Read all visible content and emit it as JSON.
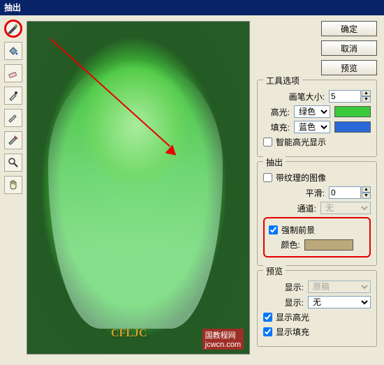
{
  "title": "抽出",
  "buttons": {
    "ok": "确定",
    "cancel": "取消",
    "preview": "预览"
  },
  "tool_options": {
    "title": "工具选项",
    "brush_size_label": "画笔大小:",
    "brush_size": "5",
    "highlight_label": "高光:",
    "highlight_value": "绿色",
    "fill_label": "填充:",
    "fill_value": "蓝色",
    "smart_highlight_label": "智能高光显示"
  },
  "extract": {
    "title": "抽出",
    "textured_label": "带纹理的图像",
    "smooth_label": "平滑:",
    "smooth_value": "0",
    "channel_label": "通道:",
    "channel_value": "无",
    "force_fg_label": "强制前景",
    "color_label": "颜色:"
  },
  "preview_group": {
    "title": "预览",
    "show_label": "显示:",
    "show_value": "原稿",
    "display_label": "显示:",
    "display_value": "无",
    "show_highlight": "显示高光",
    "show_fill": "显示填充"
  },
  "canvas": {
    "watermark": "CFLJC",
    "watermark2": "国教程网",
    "watermark3": "jcwcn.com"
  },
  "tools": {
    "edge": "edge-highlighter-icon",
    "fill": "fill-icon",
    "eraser": "eraser-icon",
    "eyedropper": "eyedropper-icon",
    "cleanup": "cleanup-icon",
    "edge_touchup": "edge-touchup-icon",
    "zoom": "zoom-icon",
    "hand": "hand-icon"
  }
}
